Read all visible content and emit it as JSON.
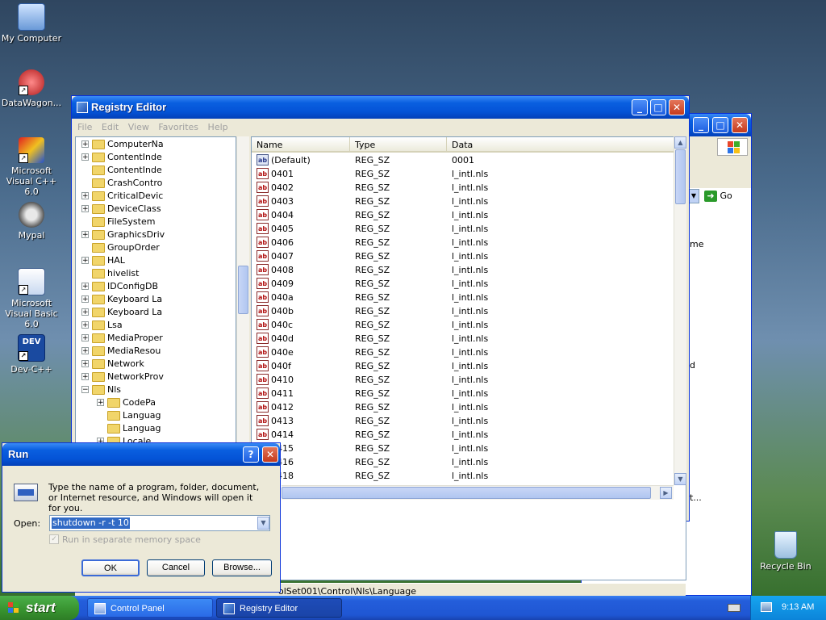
{
  "desktop": {
    "icons": [
      {
        "label": "My Computer",
        "icon": "computer-icon"
      },
      {
        "label": "DataWagon...",
        "icon": "datawagon-icon"
      },
      {
        "label": "Microsoft Visual C++ 6.0",
        "icon": "visual-cpp-icon"
      },
      {
        "label": "Mypal",
        "icon": "mypal-icon"
      },
      {
        "label": "Microsoft Visual Basic 6.0",
        "icon": "visual-basic-icon"
      },
      {
        "label": "Dev-C++",
        "icon": "devcpp-icon"
      },
      {
        "label": "Recycle Bin",
        "icon": "recycle-bin-icon"
      }
    ]
  },
  "background_window": {
    "go_label": "Go",
    "side_text_1": "me",
    "side_text_2": "d",
    "side_text_3": "t..."
  },
  "registry": {
    "title": "Registry Editor",
    "menu": [
      "File",
      "Edit",
      "View",
      "Favorites",
      "Help"
    ],
    "tree": [
      {
        "label": "ComputerNa",
        "level": 0,
        "expander": "+"
      },
      {
        "label": "ContentInde",
        "level": 0,
        "expander": "+"
      },
      {
        "label": "ContentInde",
        "level": 0,
        "expander": ""
      },
      {
        "label": "CrashContro",
        "level": 0,
        "expander": ""
      },
      {
        "label": "CriticalDevic",
        "level": 0,
        "expander": "+"
      },
      {
        "label": "DeviceClass",
        "level": 0,
        "expander": "+"
      },
      {
        "label": "FileSystem",
        "level": 0,
        "expander": ""
      },
      {
        "label": "GraphicsDriv",
        "level": 0,
        "expander": "+"
      },
      {
        "label": "GroupOrder",
        "level": 0,
        "expander": ""
      },
      {
        "label": "HAL",
        "level": 0,
        "expander": "+"
      },
      {
        "label": "hivelist",
        "level": 0,
        "expander": ""
      },
      {
        "label": "IDConfigDB",
        "level": 0,
        "expander": "+"
      },
      {
        "label": "Keyboard La",
        "level": 0,
        "expander": "+"
      },
      {
        "label": "Keyboard La",
        "level": 0,
        "expander": "+"
      },
      {
        "label": "Lsa",
        "level": 0,
        "expander": "+"
      },
      {
        "label": "MediaProper",
        "level": 0,
        "expander": "+"
      },
      {
        "label": "MediaResou",
        "level": 0,
        "expander": "+"
      },
      {
        "label": "Network",
        "level": 0,
        "expander": "+"
      },
      {
        "label": "NetworkProv",
        "level": 0,
        "expander": "+"
      },
      {
        "label": "Nls",
        "level": 0,
        "expander": "-"
      },
      {
        "label": "CodePa",
        "level": 1,
        "expander": "+"
      },
      {
        "label": "Languag",
        "level": 1,
        "expander": ""
      },
      {
        "label": "Languag",
        "level": 1,
        "expander": ""
      },
      {
        "label": "Locale",
        "level": 1,
        "expander": "+"
      }
    ],
    "columns": [
      "Name",
      "Type",
      "Data"
    ],
    "values": [
      {
        "name": "(Default)",
        "type": "REG_SZ",
        "data": "0001",
        "default": true
      },
      {
        "name": "0401",
        "type": "REG_SZ",
        "data": "l_intl.nls"
      },
      {
        "name": "0402",
        "type": "REG_SZ",
        "data": "l_intl.nls"
      },
      {
        "name": "0403",
        "type": "REG_SZ",
        "data": "l_intl.nls"
      },
      {
        "name": "0404",
        "type": "REG_SZ",
        "data": "l_intl.nls"
      },
      {
        "name": "0405",
        "type": "REG_SZ",
        "data": "l_intl.nls"
      },
      {
        "name": "0406",
        "type": "REG_SZ",
        "data": "l_intl.nls"
      },
      {
        "name": "0407",
        "type": "REG_SZ",
        "data": "l_intl.nls"
      },
      {
        "name": "0408",
        "type": "REG_SZ",
        "data": "l_intl.nls"
      },
      {
        "name": "0409",
        "type": "REG_SZ",
        "data": "l_intl.nls"
      },
      {
        "name": "040a",
        "type": "REG_SZ",
        "data": "l_intl.nls"
      },
      {
        "name": "040b",
        "type": "REG_SZ",
        "data": "l_intl.nls"
      },
      {
        "name": "040c",
        "type": "REG_SZ",
        "data": "l_intl.nls"
      },
      {
        "name": "040d",
        "type": "REG_SZ",
        "data": "l_intl.nls"
      },
      {
        "name": "040e",
        "type": "REG_SZ",
        "data": "l_intl.nls"
      },
      {
        "name": "040f",
        "type": "REG_SZ",
        "data": "l_intl.nls"
      },
      {
        "name": "0410",
        "type": "REG_SZ",
        "data": "l_intl.nls"
      },
      {
        "name": "0411",
        "type": "REG_SZ",
        "data": "l_intl.nls"
      },
      {
        "name": "0412",
        "type": "REG_SZ",
        "data": "l_intl.nls"
      },
      {
        "name": "0413",
        "type": "REG_SZ",
        "data": "l_intl.nls"
      },
      {
        "name": "0414",
        "type": "REG_SZ",
        "data": "l_intl.nls"
      },
      {
        "name": "0415",
        "type": "REG_SZ",
        "data": "l_intl.nls"
      },
      {
        "name": "0416",
        "type": "REG_SZ",
        "data": "l_intl.nls"
      },
      {
        "name": "0418",
        "type": "REG_SZ",
        "data": "l_intl.nls"
      }
    ],
    "status": "olSet001\\Control\\Nls\\Language"
  },
  "run": {
    "title": "Run",
    "description": "Type the name of a program, folder, document, or Internet resource, and Windows will open it for you.",
    "open_label": "Open:",
    "command": "shutdown -r -t 10",
    "separate_memory_label": "Run in separate memory space",
    "ok_label": "OK",
    "cancel_label": "Cancel",
    "browse_label": "Browse..."
  },
  "taskbar": {
    "start_label": "start",
    "tasks": [
      {
        "label": "Control Panel",
        "icon": "control-panel-icon"
      },
      {
        "label": "Registry Editor",
        "icon": "registry-editor-icon"
      }
    ],
    "clock": "9:13 AM"
  },
  "colors": {
    "xp_blue": "#0453d6",
    "start_green": "#37922f",
    "close_red": "#c53a1c"
  }
}
